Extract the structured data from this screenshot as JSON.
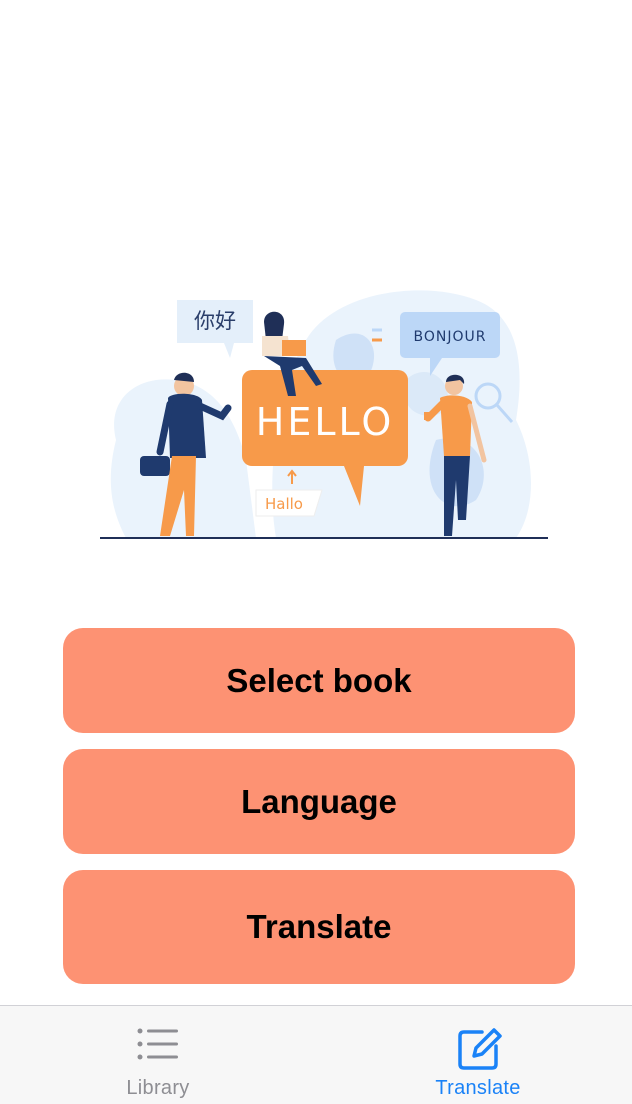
{
  "illustration": {
    "bubble_chinese": "你好",
    "bubble_hello": "HELLO",
    "bubble_bonjour": "BONJOUR",
    "bubble_hallo": "Hallo"
  },
  "actions": {
    "select_book_label": "Select book",
    "language_label": "Language",
    "translate_label": "Translate"
  },
  "tab_bar": {
    "tabs": [
      {
        "label": "Library",
        "icon": "list-icon",
        "active": false
      },
      {
        "label": "Translate",
        "icon": "edit-icon",
        "active": true
      }
    ]
  },
  "colors": {
    "button": "#fd9273",
    "tab_active": "#1a82f7",
    "tab_inactive": "#8e8e93",
    "illustration_orange": "#f79a4a",
    "illustration_navy": "#1f3a6e",
    "illustration_blue_light": "#eaf3fc"
  }
}
